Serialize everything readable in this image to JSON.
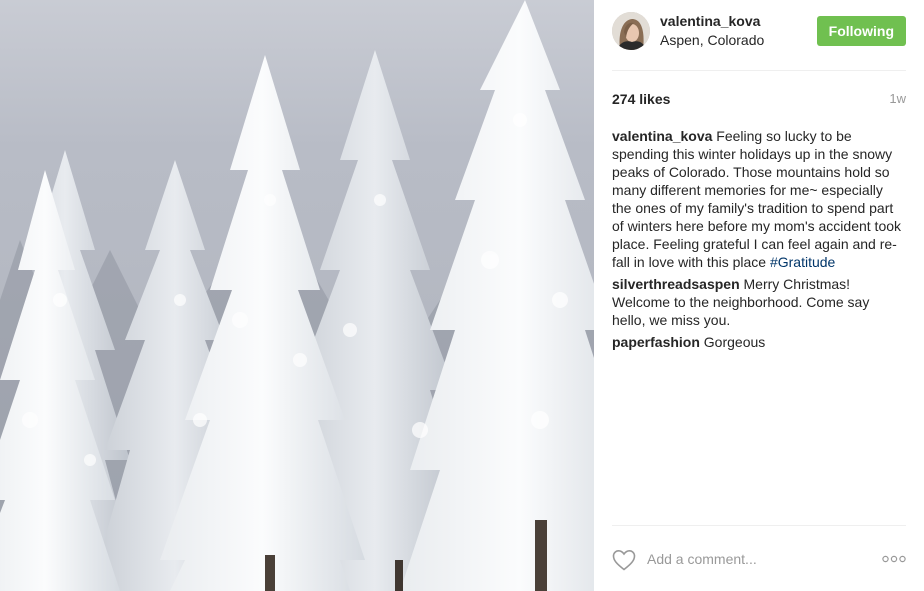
{
  "post": {
    "image_alt": "Snow-covered pine trees under a grey winter sky",
    "author": {
      "username": "valentina_kova",
      "location": "Aspen, Colorado",
      "follow_label": "Following"
    },
    "likes": "274 likes",
    "time_ago": "1w",
    "caption": {
      "author": "valentina_kova",
      "text": "Feeling so lucky to be spending this winter holidays up in the snowy peaks of Colorado. Those mountains hold so many different memories for me~ especially the ones of my family's tradition to spend part of winters here before my mom's accident took place. Feeling grateful I can feel again and re-fall in love with this place",
      "hashtag": "#Gratitude"
    },
    "comments": [
      {
        "author": "silverthreadsaspen",
        "text": "Merry Christmas! Welcome to the neighborhood. Come say hello, we miss you."
      },
      {
        "author": "paperfashion",
        "text": "Gorgeous"
      }
    ],
    "add_comment_placeholder": "Add a comment...",
    "icons": {
      "like": "heart-icon",
      "options": "more-options-icon"
    },
    "colors": {
      "follow_button": "#70c050",
      "hashtag": "#003569",
      "meta_text": "#999999"
    }
  }
}
